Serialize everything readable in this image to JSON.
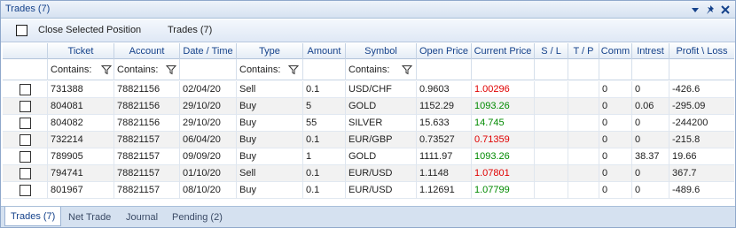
{
  "window": {
    "title": "Trades (7)"
  },
  "toolbar": {
    "close_selected_label": "Close Selected Position",
    "trades_label": "Trades (7)"
  },
  "grid": {
    "columns": [
      "Ticket",
      "Account",
      "Date / Time",
      "Type",
      "Amount",
      "Symbol",
      "Open Price",
      "Current Price",
      "S / L",
      "T / P",
      "Comm",
      "Intrest",
      "Profit \\ Loss"
    ],
    "filters": {
      "ticket": "Contains:",
      "account": "Contains:",
      "type": "Contains:",
      "symbol": "Contains:"
    },
    "rows": [
      {
        "ticket": "731388",
        "account": "78821156",
        "datetime": "02/04/20",
        "type": "Sell",
        "amount": "0.1",
        "symbol": "USD/CHF",
        "open": "0.9603",
        "current": "1.00296",
        "current_color": "red",
        "sl": "",
        "tp": "",
        "comm": "0",
        "interest": "0",
        "pl": "-426.6"
      },
      {
        "ticket": "804081",
        "account": "78821156",
        "datetime": "29/10/20",
        "type": "Buy",
        "amount": "5",
        "symbol": "GOLD",
        "open": "1152.29",
        "current": "1093.26",
        "current_color": "green",
        "sl": "",
        "tp": "",
        "comm": "0",
        "interest": "0.06",
        "pl": "-295.09"
      },
      {
        "ticket": "804082",
        "account": "78821156",
        "datetime": "29/10/20",
        "type": "Buy",
        "amount": "55",
        "symbol": "SILVER",
        "open": "15.633",
        "current": "14.745",
        "current_color": "green",
        "sl": "",
        "tp": "",
        "comm": "0",
        "interest": "0",
        "pl": "-244200"
      },
      {
        "ticket": "732214",
        "account": "78821157",
        "datetime": "06/04/20",
        "type": "Buy",
        "amount": "0.1",
        "symbol": "EUR/GBP",
        "open": "0.73527",
        "current": "0.71359",
        "current_color": "red",
        "sl": "",
        "tp": "",
        "comm": "0",
        "interest": "0",
        "pl": "-215.8"
      },
      {
        "ticket": "789905",
        "account": "78821157",
        "datetime": "09/09/20",
        "type": "Buy",
        "amount": "1",
        "symbol": "GOLD",
        "open": "1111.97",
        "current": "1093.26",
        "current_color": "green",
        "sl": "",
        "tp": "",
        "comm": "0",
        "interest": "38.37",
        "pl": "19.66"
      },
      {
        "ticket": "794741",
        "account": "78821157",
        "datetime": "01/10/20",
        "type": "Sell",
        "amount": "0.1",
        "symbol": "EUR/USD",
        "open": "1.1148",
        "current": "1.07801",
        "current_color": "red",
        "sl": "",
        "tp": "",
        "comm": "0",
        "interest": "0",
        "pl": "367.7"
      },
      {
        "ticket": "801967",
        "account": "78821157",
        "datetime": "08/10/20",
        "type": "Buy",
        "amount": "0.1",
        "symbol": "EUR/USD",
        "open": "1.12691",
        "current": "1.07799",
        "current_color": "green",
        "sl": "",
        "tp": "",
        "comm": "0",
        "interest": "0",
        "pl": "-489.6"
      }
    ]
  },
  "tabs": [
    "Trades (7)",
    "Net Trade",
    "Journal",
    "Pending (2)"
  ],
  "colors": {
    "title_text": "#15428b",
    "price_up": "#008a00",
    "price_down": "#e00000"
  }
}
